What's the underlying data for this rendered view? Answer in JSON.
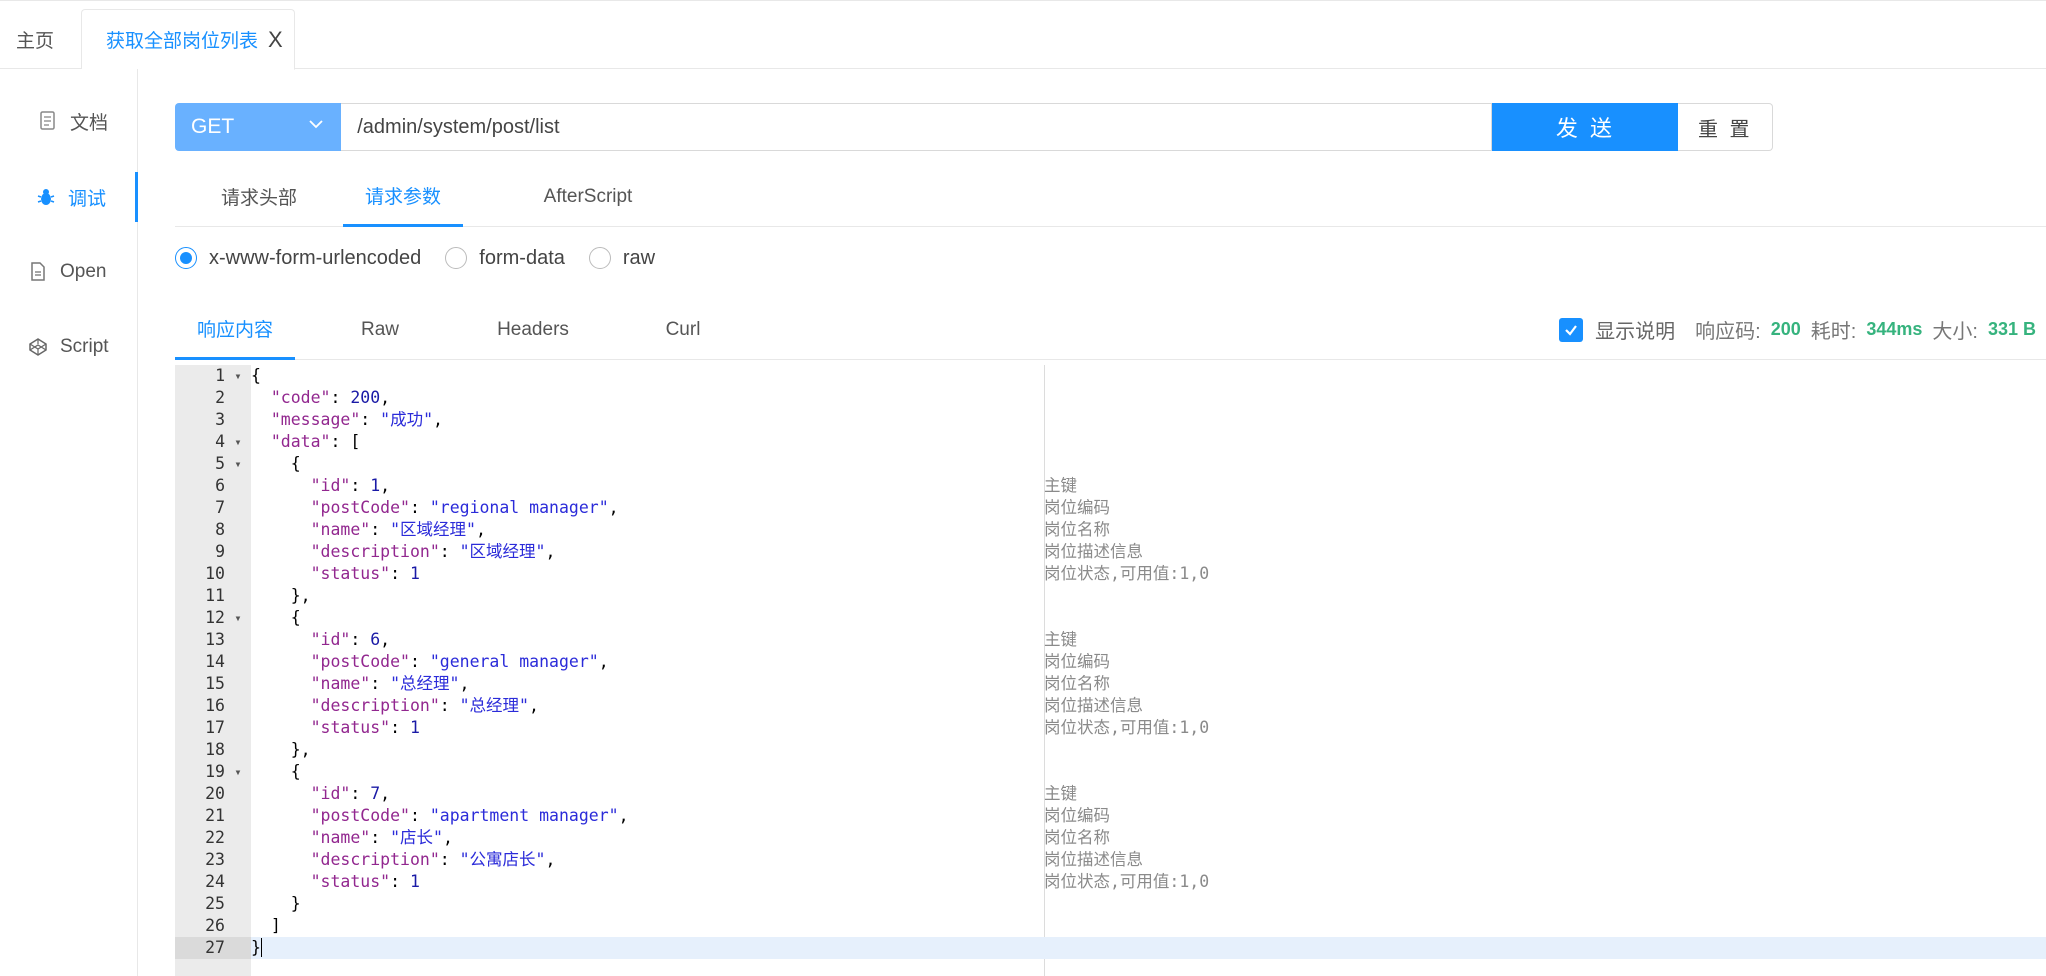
{
  "page_tabs": {
    "home": "主页",
    "active": "获取全部岗位列表",
    "close": "X"
  },
  "sidebar": {
    "items": [
      {
        "label": "文档",
        "icon": "doc-icon"
      },
      {
        "label": "调试",
        "icon": "bug-icon"
      },
      {
        "label": "Open",
        "icon": "file-icon"
      },
      {
        "label": "Script",
        "icon": "codepen-icon"
      }
    ]
  },
  "request": {
    "method": "GET",
    "url": "/admin/system/post/list",
    "send_label": "发 送",
    "reset_label": "重 置"
  },
  "request_tabs": [
    "请求头部",
    "请求参数",
    "AfterScript"
  ],
  "body_types": [
    "x-www-form-urlencoded",
    "form-data",
    "raw"
  ],
  "response_tabs": [
    "响应内容",
    "Raw",
    "Headers",
    "Curl"
  ],
  "response_meta": {
    "show_desc_label": "显示说明",
    "code_label": "响应码:",
    "code_value": "200",
    "time_label": "耗时:",
    "time_value": "344ms",
    "size_label": "大小:",
    "size_value": "331 B"
  },
  "editor": {
    "lines": [
      {
        "n": "1",
        "fold": "▾",
        "html": "{",
        "comment": ""
      },
      {
        "n": "2",
        "fold": "",
        "html": "  <span class='k'>\"code\"</span>: <span class='n'>200</span>,",
        "comment": ""
      },
      {
        "n": "3",
        "fold": "",
        "html": "  <span class='k'>\"message\"</span>: <span class='s'>\"成功\"</span>,",
        "comment": ""
      },
      {
        "n": "4",
        "fold": "▾",
        "html": "  <span class='k'>\"data\"</span>: [",
        "comment": ""
      },
      {
        "n": "5",
        "fold": "▾",
        "html": "    {",
        "comment": ""
      },
      {
        "n": "6",
        "fold": "",
        "html": "      <span class='k'>\"id\"</span>: <span class='n'>1</span>,",
        "comment": "主键"
      },
      {
        "n": "7",
        "fold": "",
        "html": "      <span class='k'>\"postCode\"</span>: <span class='s'>\"regional manager\"</span>,",
        "comment": "岗位编码"
      },
      {
        "n": "8",
        "fold": "",
        "html": "      <span class='k'>\"name\"</span>: <span class='s'>\"区域经理\"</span>,",
        "comment": "岗位名称"
      },
      {
        "n": "9",
        "fold": "",
        "html": "      <span class='k'>\"description\"</span>: <span class='s'>\"区域经理\"</span>,",
        "comment": "岗位描述信息"
      },
      {
        "n": "10",
        "fold": "",
        "html": "      <span class='k'>\"status\"</span>: <span class='n'>1</span>",
        "comment": "岗位状态,可用值:1,0"
      },
      {
        "n": "11",
        "fold": "",
        "html": "    },",
        "comment": ""
      },
      {
        "n": "12",
        "fold": "▾",
        "html": "    {",
        "comment": ""
      },
      {
        "n": "13",
        "fold": "",
        "html": "      <span class='k'>\"id\"</span>: <span class='n'>6</span>,",
        "comment": "主键"
      },
      {
        "n": "14",
        "fold": "",
        "html": "      <span class='k'>\"postCode\"</span>: <span class='s'>\"general manager\"</span>,",
        "comment": "岗位编码"
      },
      {
        "n": "15",
        "fold": "",
        "html": "      <span class='k'>\"name\"</span>: <span class='s'>\"总经理\"</span>,",
        "comment": "岗位名称"
      },
      {
        "n": "16",
        "fold": "",
        "html": "      <span class='k'>\"description\"</span>: <span class='s'>\"总经理\"</span>,",
        "comment": "岗位描述信息"
      },
      {
        "n": "17",
        "fold": "",
        "html": "      <span class='k'>\"status\"</span>: <span class='n'>1</span>",
        "comment": "岗位状态,可用值:1,0"
      },
      {
        "n": "18",
        "fold": "",
        "html": "    },",
        "comment": ""
      },
      {
        "n": "19",
        "fold": "▾",
        "html": "    {",
        "comment": ""
      },
      {
        "n": "20",
        "fold": "",
        "html": "      <span class='k'>\"id\"</span>: <span class='n'>7</span>,",
        "comment": "主键"
      },
      {
        "n": "21",
        "fold": "",
        "html": "      <span class='k'>\"postCode\"</span>: <span class='s'>\"apartment manager\"</span>,",
        "comment": "岗位编码"
      },
      {
        "n": "22",
        "fold": "",
        "html": "      <span class='k'>\"name\"</span>: <span class='s'>\"店长\"</span>,",
        "comment": "岗位名称"
      },
      {
        "n": "23",
        "fold": "",
        "html": "      <span class='k'>\"description\"</span>: <span class='s'>\"公寓店长\"</span>,",
        "comment": "岗位描述信息"
      },
      {
        "n": "24",
        "fold": "",
        "html": "      <span class='k'>\"status\"</span>: <span class='n'>1</span>",
        "comment": "岗位状态,可用值:1,0"
      },
      {
        "n": "25",
        "fold": "",
        "html": "    }",
        "comment": ""
      },
      {
        "n": "26",
        "fold": "",
        "html": "  ]",
        "comment": ""
      },
      {
        "n": "27",
        "fold": "",
        "html": "}<span class='cursor'></span>",
        "comment": ""
      }
    ]
  },
  "colors": {
    "accent": "#1890ff",
    "method_bg": "#69b1ff",
    "metric_green": "#36b37e"
  }
}
